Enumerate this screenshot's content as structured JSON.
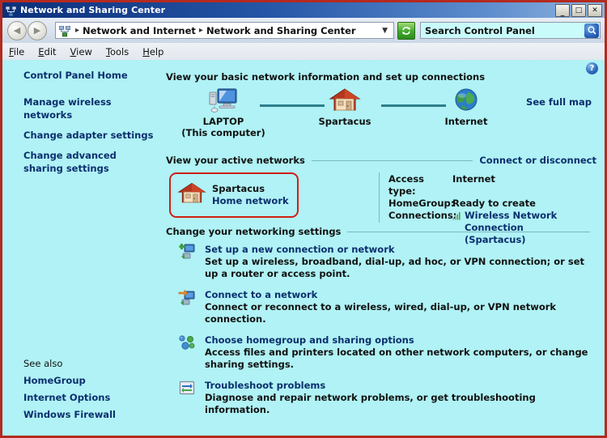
{
  "window": {
    "title": "Network and Sharing Center",
    "title_icon": "network-icon",
    "buttons": {
      "minimize": "_",
      "maximize": "□",
      "close": "✕"
    },
    "frame_color": "#b42a1f",
    "titlebar_color": "#0b2f7a"
  },
  "addressbar": {
    "back_arrow": "◀",
    "forward_arrow": "▶",
    "path_icon": "network-icon",
    "separator": "▸",
    "crumbs": [
      "Network and Internet",
      "Network and Sharing Center"
    ],
    "dropdown_arrow": "▼",
    "refresh_icon": "refresh-icon",
    "search": {
      "value": "Search Control Panel",
      "placeholder": "Search Control Panel",
      "icon": "search-icon"
    }
  },
  "menubar": {
    "items": [
      {
        "label": "File",
        "accel": "F",
        "rest": "ile"
      },
      {
        "label": "Edit",
        "accel": "E",
        "rest": "dit"
      },
      {
        "label": "View",
        "accel": "V",
        "rest": "iew"
      },
      {
        "label": "Tools",
        "accel": "T",
        "rest": "ools"
      },
      {
        "label": "Help",
        "accel": "H",
        "rest": "elp"
      }
    ]
  },
  "sidebar": {
    "home_label": "Control Panel Home",
    "items": [
      {
        "label": "Manage wireless networks"
      },
      {
        "label": "Change adapter settings"
      },
      {
        "label": "Change advanced sharing settings"
      }
    ],
    "see_also": {
      "heading": "See also",
      "items": [
        {
          "label": "HomeGroup"
        },
        {
          "label": "Internet Options"
        },
        {
          "label": "Windows Firewall"
        }
      ]
    }
  },
  "main": {
    "help_icon": "help-icon",
    "map_section": {
      "title": "View your basic network information and set up connections",
      "see_full_map": "See full map",
      "nodes": [
        {
          "icon": "computer-icon",
          "label": "LAPTOP",
          "sublabel": "(This computer)"
        },
        {
          "icon": "house-icon",
          "label": "Spartacus",
          "sublabel": ""
        },
        {
          "icon": "globe-icon",
          "label": "Internet",
          "sublabel": ""
        }
      ]
    },
    "active_section": {
      "title": "View your active networks",
      "right_link": "Connect or disconnect",
      "network": {
        "icon": "house-icon",
        "name": "Spartacus",
        "type": "Home network",
        "highlight_color": "#d01f14"
      },
      "details": [
        {
          "label": "Access type:",
          "value": "Internet",
          "is_link": false,
          "icon": ""
        },
        {
          "label": "HomeGroup:",
          "value": "Ready to create",
          "is_link": false,
          "icon": ""
        },
        {
          "label": "Connections:",
          "value": "Wireless Network Connection (Spartacus)",
          "is_link": true,
          "icon": "signal-bars-icon"
        }
      ]
    },
    "settings_section": {
      "title": "Change your networking settings",
      "items": [
        {
          "icon": "new-connection-icon",
          "title": "Set up a new connection or network",
          "desc": "Set up a wireless, broadband, dial-up, ad hoc, or VPN connection; or set up a router or access point."
        },
        {
          "icon": "connect-network-icon",
          "title": "Connect to a network",
          "desc": "Connect or reconnect to a wireless, wired, dial-up, or VPN network connection."
        },
        {
          "icon": "homegroup-icon",
          "title": "Choose homegroup and sharing options",
          "desc": "Access files and printers located on other network computers, or change sharing settings."
        },
        {
          "icon": "troubleshoot-icon",
          "title": "Troubleshoot problems",
          "desc": "Diagnose and repair network problems, or get troubleshooting information."
        }
      ]
    }
  }
}
